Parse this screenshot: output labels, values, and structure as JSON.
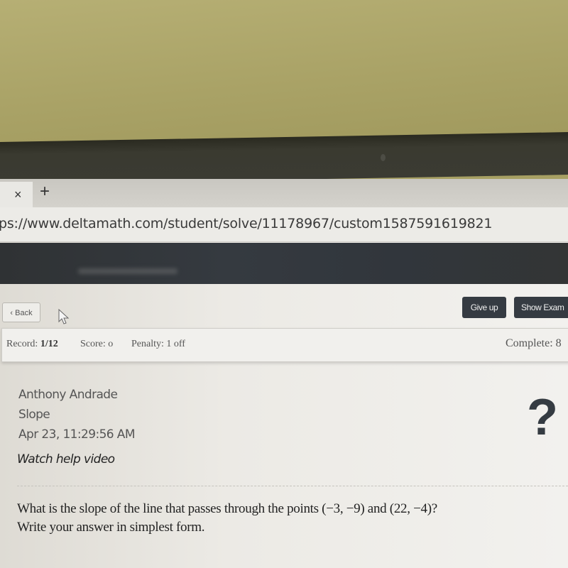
{
  "browser": {
    "tab": {
      "close_icon": "×",
      "new_tab_icon": "+"
    },
    "url": "ps://www.deltamath.com/student/solve/11178967/custom1587591619821"
  },
  "toolbar": {
    "back_label": "Back",
    "back_icon": "‹",
    "give_up_label": "Give up",
    "show_example_label": "Show Exam"
  },
  "record_bar": {
    "record_label": "Record:",
    "record_value": "1/12",
    "score_text": "Score: o",
    "penalty_text": "Penalty: 1 off",
    "complete_text": "Complete: 8"
  },
  "info": {
    "student_name": "Anthony Andrade",
    "topic": "Slope",
    "timestamp": "Apr 23, 11:29:56 AM",
    "help_link": "Watch help video",
    "help_icon": "?"
  },
  "question": {
    "line1": "What is the slope of the line that passes through the points (−3, −9) and (22, −4)?",
    "line2": "Write your answer in simplest form."
  },
  "colors": {
    "header_dark": "#31363c",
    "button_dark": "#353b42",
    "wall": "#a9a266"
  }
}
